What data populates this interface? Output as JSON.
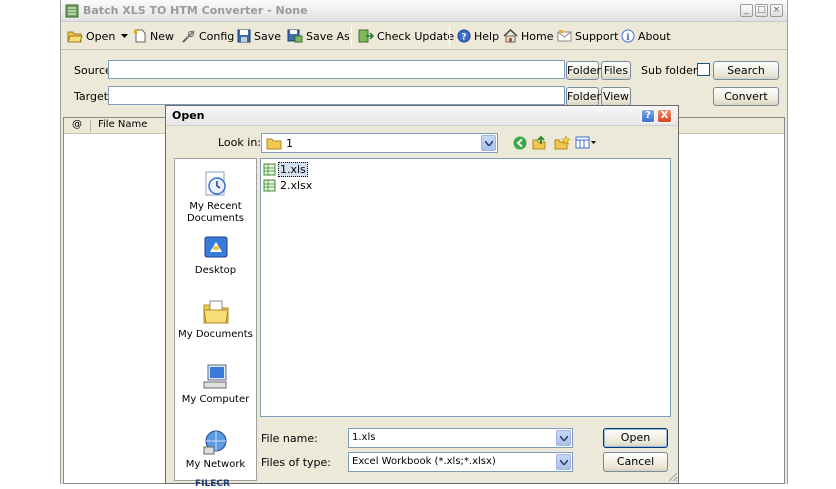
{
  "main": {
    "title": "Batch XLS TO HTM Converter - None",
    "toolbar": {
      "open": "Open",
      "new": "New",
      "config": "Config",
      "save": "Save",
      "save_as": "Save As",
      "check_update": "Check Update",
      "help": "Help",
      "home": "Home",
      "support": "Support",
      "about": "About"
    },
    "source_label": "Source",
    "target_label": "Target",
    "source_value": "",
    "target_value": "",
    "source_folder_btn": "Folder",
    "source_files_btn": "Files",
    "subfolders_label": "Sub folders",
    "search_btn": "Search",
    "target_folder_btn": "Folder",
    "target_view_btn": "View",
    "convert_btn": "Convert",
    "columns": [
      "@",
      "File Name"
    ]
  },
  "dialog": {
    "title": "Open",
    "help_glyph": "?",
    "close_glyph": "X",
    "look_in_label": "Look in:",
    "look_in_value": "1",
    "places": [
      "My Recent Documents",
      "Desktop",
      "My Documents",
      "My Computer",
      "My Network"
    ],
    "files": [
      "1.xls",
      "2.xlsx"
    ],
    "file_name_label": "File name:",
    "file_name_value": "1.xls",
    "files_of_type_label": "Files of type:",
    "files_of_type_value": "Excel Workbook (*.xls;*.xlsx)",
    "open_btn": "Open",
    "cancel_btn": "Cancel",
    "watermark": "FILECR"
  },
  "colors": {
    "window_bg": "#ece9d8",
    "field_border": "#7f9db9",
    "selection": "#316ac5"
  }
}
